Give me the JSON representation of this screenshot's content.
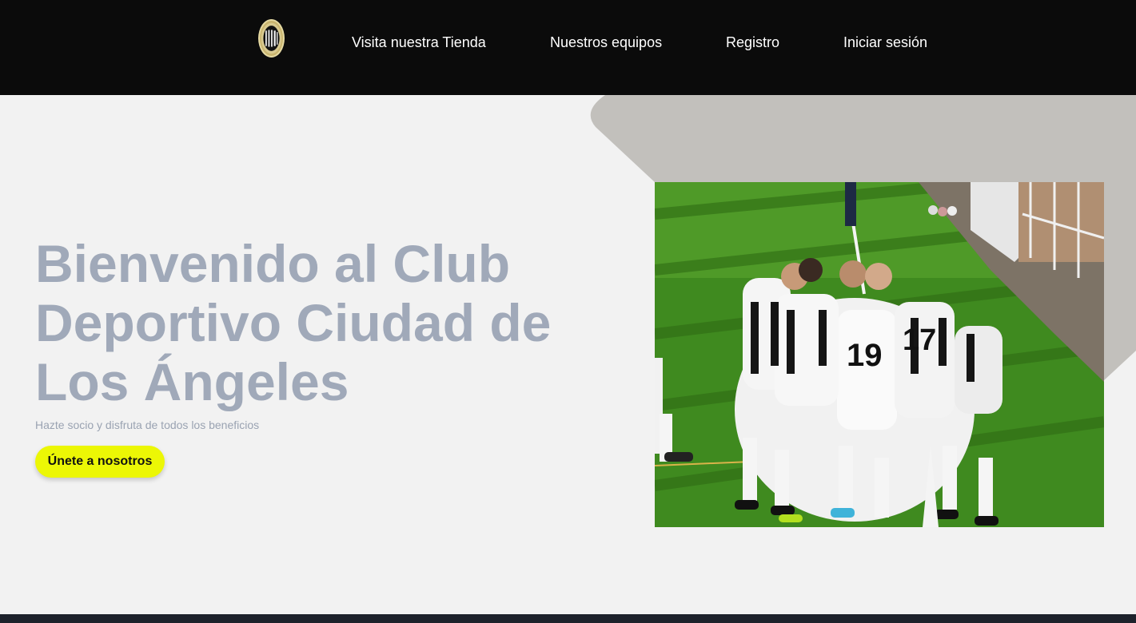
{
  "nav": {
    "logo_icon": "club-crest-icon",
    "links": [
      {
        "label": "Visita nuestra Tienda"
      },
      {
        "label": "Nuestros equipos"
      },
      {
        "label": "Registro"
      },
      {
        "label": "Iniciar sesión"
      }
    ]
  },
  "hero": {
    "title": "Bienvenido al Club Deportivo Ciudad de Los Ángeles",
    "subtitle": "Hazte socio y disfruta de todos los beneficios",
    "cta_label": "Únete a nosotros",
    "photo_icon": "team-celebration-photo"
  },
  "colors": {
    "nav_bg": "#0b0b0b",
    "page_bg": "#f2f2f2",
    "title": "#a0a9b9",
    "accent_button": "#ecf705",
    "shape": "#c2c0bc",
    "footer": "#1d222b"
  }
}
